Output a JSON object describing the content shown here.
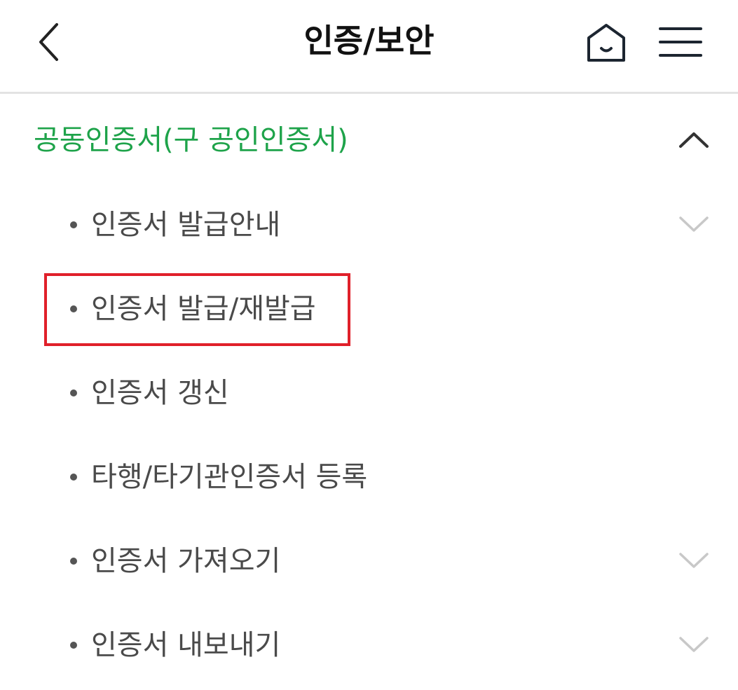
{
  "header": {
    "title": "인증/보안",
    "back_icon": "chevron-left-icon",
    "home_icon": "home-icon",
    "menu_icon": "hamburger-menu-icon"
  },
  "section": {
    "title": "공동인증서(구 공인인증서)",
    "expanded": true,
    "toggle_icon": "chevron-up-icon",
    "accent_color": "#1ea34a"
  },
  "items": [
    {
      "label": "인증서 발급안내",
      "has_submenu": true
    },
    {
      "label": "인증서 발급/재발급",
      "has_submenu": false,
      "highlighted": true
    },
    {
      "label": "인증서 갱신",
      "has_submenu": false
    },
    {
      "label": "타행/타기관인증서 등록",
      "has_submenu": false
    },
    {
      "label": "인증서 가져오기",
      "has_submenu": true
    },
    {
      "label": "인증서 내보내기",
      "has_submenu": true
    }
  ],
  "highlight_color": "#e0202a"
}
